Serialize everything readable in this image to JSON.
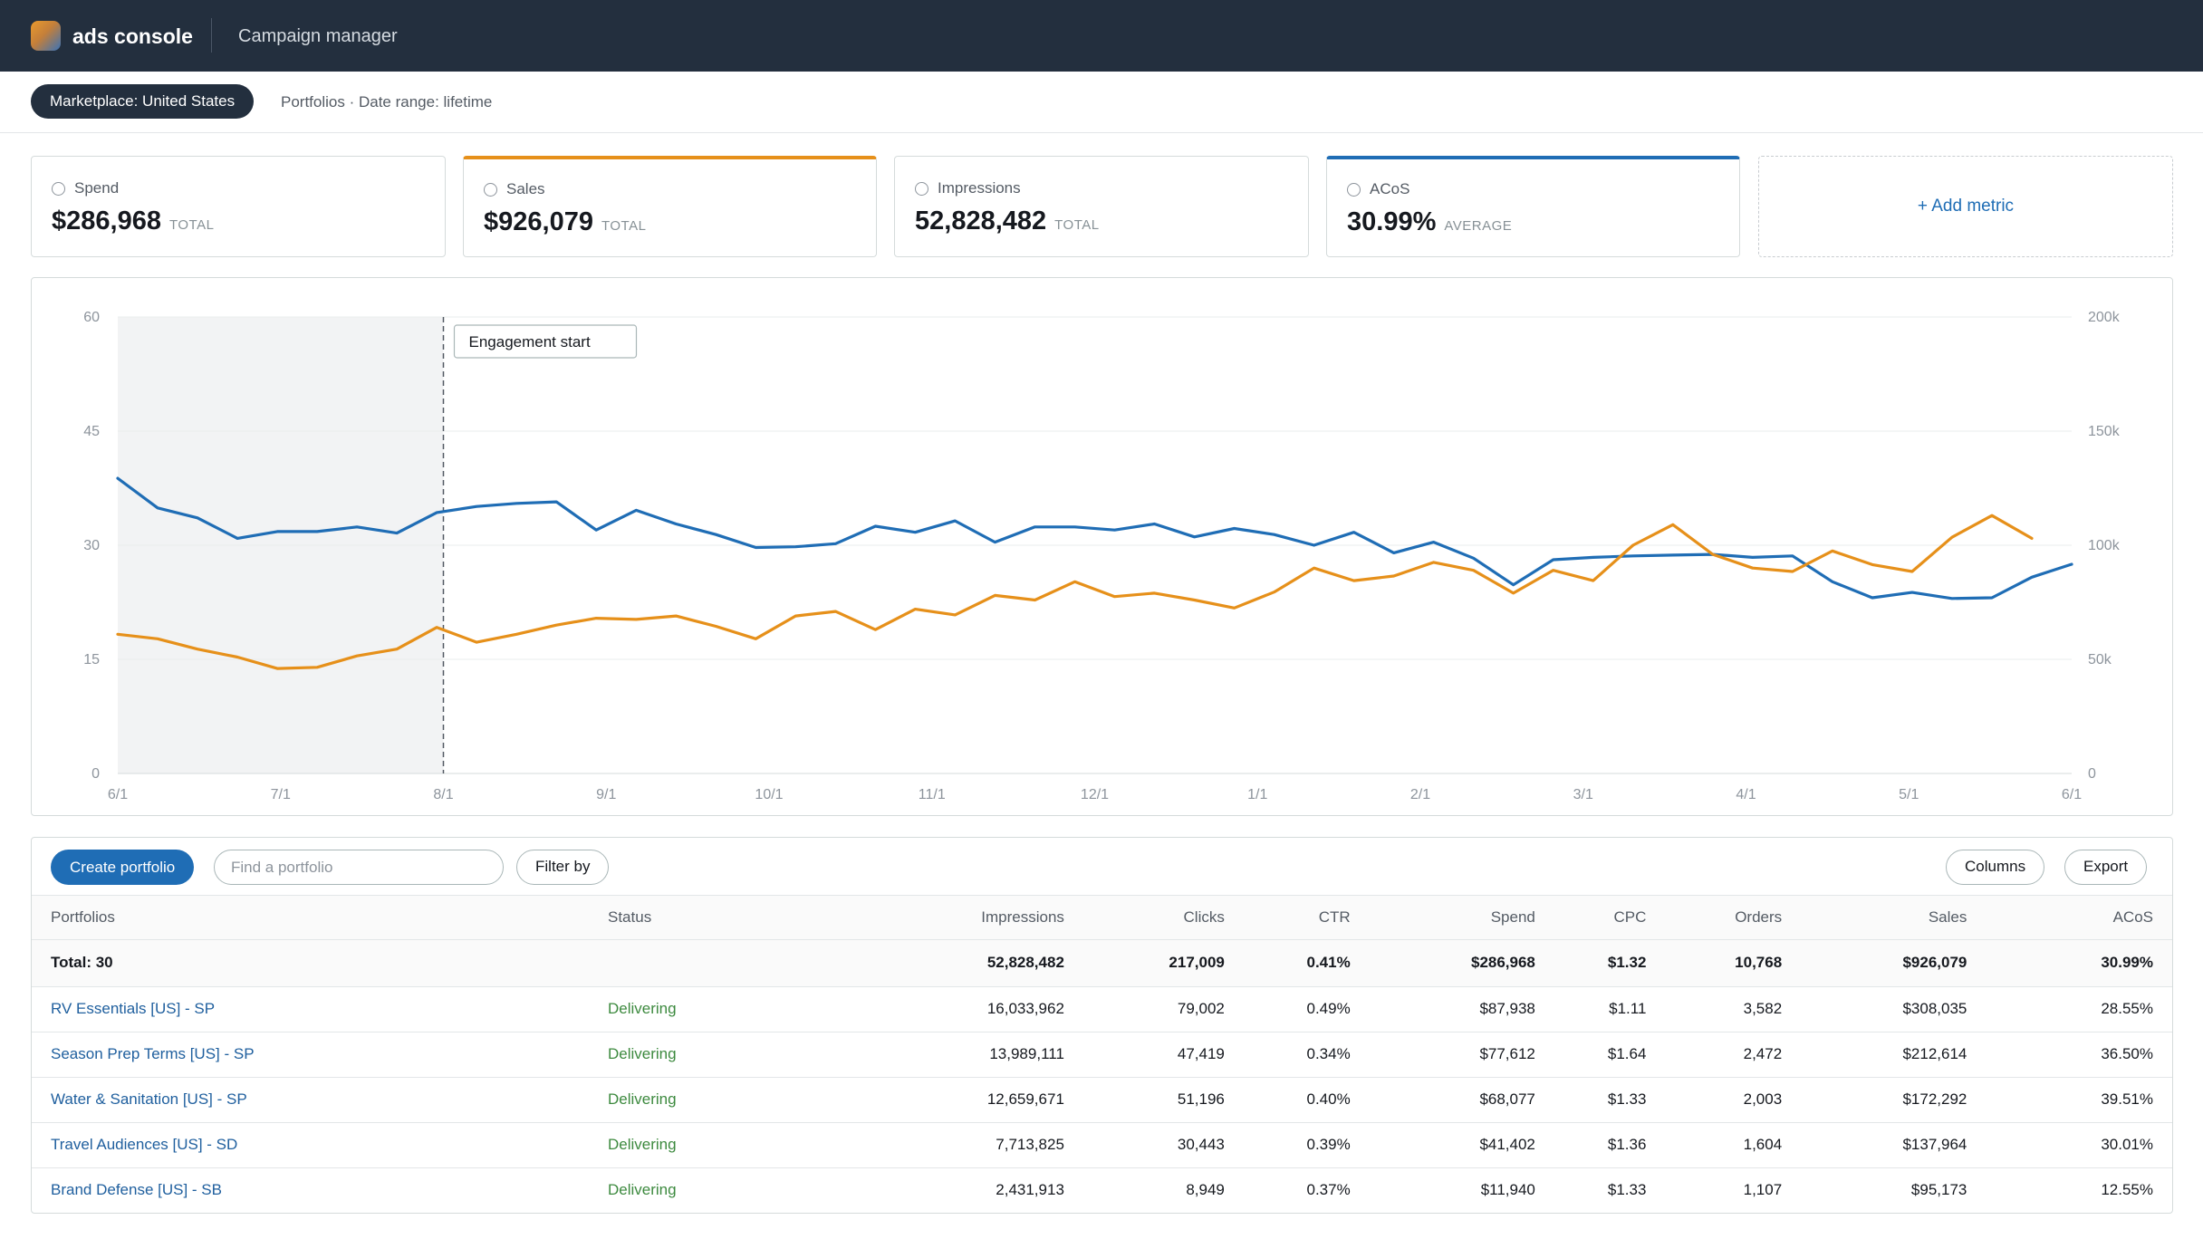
{
  "app": {
    "name": "ads console",
    "section": "Campaign manager",
    "marketplace": "Marketplace: United States",
    "breadcrumb": "Portfolios · Date range: lifetime"
  },
  "metrics": [
    {
      "label": "Spend",
      "value": "$286,968",
      "unit": "TOTAL",
      "selected": false
    },
    {
      "label": "Sales",
      "value": "$926,079",
      "unit": "TOTAL",
      "selected": true,
      "accent": "#e6901a"
    },
    {
      "label": "Impressions",
      "value": "52,828,482",
      "unit": "TOTAL",
      "selected": false
    },
    {
      "label": "ACoS",
      "value": "30.99%",
      "unit": "AVERAGE",
      "selected": true,
      "accent": "#1f6db5"
    }
  ],
  "add_metric_label": "+ Add metric",
  "chart_data": {
    "type": "line",
    "x": [
      "6/1",
      "6/8",
      "6/15",
      "6/22",
      "6/29",
      "7/6",
      "7/13",
      "7/20",
      "7/27",
      "8/3",
      "8/10",
      "8/17",
      "8/24",
      "8/31",
      "9/7",
      "9/14",
      "9/21",
      "9/28",
      "10/5",
      "10/12",
      "10/19",
      "10/26",
      "11/2",
      "11/9",
      "11/16",
      "11/23",
      "11/30",
      "12/7",
      "12/14",
      "12/21",
      "12/28",
      "1/4",
      "1/11",
      "1/18",
      "1/25",
      "2/1",
      "2/8",
      "2/15",
      "2/22",
      "3/1",
      "3/8",
      "3/15",
      "3/22",
      "3/29",
      "4/5",
      "4/12",
      "4/19",
      "4/26",
      "5/3",
      "5/10",
      "5/17",
      "5/24",
      "5/31",
      "6/1"
    ],
    "x_ticks": [
      "6/1",
      "7/1",
      "8/1",
      "9/1",
      "10/1",
      "11/1",
      "12/1",
      "1/1",
      "2/1",
      "3/1",
      "4/1",
      "5/1",
      "6/1"
    ],
    "series": [
      {
        "name": "ACoS",
        "axis": "left",
        "color": "#1f6db5",
        "values": [
          38.8,
          34.9,
          33.6,
          30.9,
          31.8,
          31.8,
          32.4,
          31.6,
          34.3,
          35.1,
          35.5,
          35.7,
          32.0,
          34.6,
          32.8,
          31.4,
          29.7,
          29.8,
          30.2,
          32.5,
          31.7,
          33.2,
          30.4,
          32.4,
          32.4,
          32.0,
          32.8,
          31.1,
          32.2,
          31.4,
          30.0,
          31.7,
          29.0,
          30.4,
          28.3,
          24.8,
          28.1,
          28.4,
          28.6,
          28.7,
          28.8,
          28.4,
          28.6,
          25.2,
          23.1,
          23.8,
          23.0,
          23.1,
          25.8,
          27.5
        ]
      },
      {
        "name": "Sales",
        "axis": "right",
        "color": "#e6901a",
        "values": [
          61000,
          59000,
          54500,
          51000,
          46000,
          46500,
          51500,
          54500,
          64000,
          57500,
          61000,
          65000,
          68000,
          67500,
          69000,
          64500,
          59000,
          69000,
          71000,
          63000,
          72000,
          69500,
          78000,
          76000,
          84000,
          77500,
          79000,
          76000,
          72500,
          79500,
          90000,
          84500,
          86500,
          92500,
          89000,
          79000,
          89000,
          84500,
          100000,
          109000,
          96000,
          90000,
          88500,
          97500,
          91500,
          88500,
          103500,
          113000,
          103000
        ]
      }
    ],
    "y_left": {
      "ticks": [
        0,
        15,
        30,
        45,
        60
      ],
      "range": [
        0,
        60
      ]
    },
    "y_right": {
      "ticks": [
        "0",
        "50k",
        "100k",
        "150k",
        "200k"
      ],
      "range": [
        0,
        200000
      ]
    },
    "annotation": {
      "label": "Engagement start",
      "x": "8/1"
    },
    "shaded_range": [
      "6/1",
      "8/1"
    ],
    "grid": true
  },
  "toolbar": {
    "create_label": "Create portfolio",
    "search_placeholder": "Find a portfolio",
    "filter_label": "Filter by",
    "columns_label": "Columns",
    "export_label": "Export"
  },
  "table": {
    "headers": [
      "Portfolios",
      "Status",
      "Impressions",
      "Clicks",
      "CTR",
      "Spend",
      "CPC",
      "Orders",
      "Sales",
      "ACoS"
    ],
    "total": [
      "Total: 30",
      "",
      "52,828,482",
      "217,009",
      "0.41%",
      "$286,968",
      "$1.32",
      "10,768",
      "$926,079",
      "30.99%"
    ],
    "rows": [
      [
        "RV Essentials [US] - SP",
        "Delivering",
        "16,033,962",
        "79,002",
        "0.49%",
        "$87,938",
        "$1.11",
        "3,582",
        "$308,035",
        "28.55%"
      ],
      [
        "Season Prep Terms [US] - SP",
        "Delivering",
        "13,989,111",
        "47,419",
        "0.34%",
        "$77,612",
        "$1.64",
        "2,472",
        "$212,614",
        "36.50%"
      ],
      [
        "Water & Sanitation [US] - SP",
        "Delivering",
        "12,659,671",
        "51,196",
        "0.40%",
        "$68,077",
        "$1.33",
        "2,003",
        "$172,292",
        "39.51%"
      ],
      [
        "Travel Audiences [US] - SD",
        "Delivering",
        "7,713,825",
        "30,443",
        "0.39%",
        "$41,402",
        "$1.36",
        "1,604",
        "$137,964",
        "30.01%"
      ],
      [
        "Brand Defense [US] - SB",
        "Delivering",
        "2,431,913",
        "8,949",
        "0.37%",
        "$11,940",
        "$1.33",
        "1,107",
        "$95,173",
        "12.55%"
      ]
    ]
  }
}
